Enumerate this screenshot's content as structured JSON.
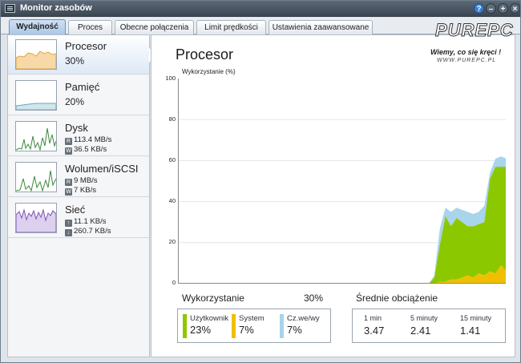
{
  "window": {
    "title": "Monitor zasobów"
  },
  "titlebar_buttons": [
    {
      "icon": "help-icon",
      "glyph": "?"
    },
    {
      "icon": "minimize-icon",
      "glyph": "–"
    },
    {
      "icon": "maximize-icon",
      "glyph": "+"
    },
    {
      "icon": "close-icon",
      "glyph": "×"
    }
  ],
  "tabs": [
    {
      "label": "Wydajność",
      "active": true
    },
    {
      "label": "Proces",
      "active": false
    },
    {
      "label": "Obecne połączenia",
      "active": false
    },
    {
      "label": "Limit prędkości",
      "active": false
    },
    {
      "label": "Ustawienia zaawansowane",
      "active": false
    }
  ],
  "sidebar": {
    "items": [
      {
        "name": "Procesor",
        "value": "30%",
        "selected": true,
        "color": "#e4a33a"
      },
      {
        "name": "Pamięć",
        "value": "20%",
        "selected": false,
        "color": "#6aa6b8"
      },
      {
        "name": "Dysk",
        "read_badge": "R",
        "read": "113.4 MB/s",
        "write_badge": "W",
        "write": "36.5 KB/s",
        "color": "#3a8a3a"
      },
      {
        "name": "Wolumen/iSCSI",
        "read_badge": "R",
        "read": "9 MB/s",
        "write_badge": "W",
        "write": "7 KB/s",
        "color": "#3a8a3a"
      },
      {
        "name": "Sieć",
        "up_badge": "↑",
        "up": "11.1 KB/s",
        "down_badge": "↓",
        "down": "260.7 KB/s",
        "color": "#7a55b5"
      }
    ]
  },
  "main": {
    "title": "Procesor",
    "ylabel": "Wykorzystanie (%)",
    "yticks": [
      "100",
      "80",
      "60",
      "40",
      "20",
      "0"
    ]
  },
  "chart_data": {
    "type": "area",
    "ylabel": "Wykorzystanie (%)",
    "ylim": [
      0,
      100
    ],
    "grid": true,
    "x_sample_count": 60,
    "series": [
      {
        "name": "System",
        "color": "#f0c000",
        "values": [
          0,
          0,
          0,
          0,
          0,
          0,
          0,
          0,
          0,
          0,
          0,
          0,
          0,
          0,
          0,
          0,
          0,
          0,
          0,
          0,
          0,
          0,
          0,
          0,
          0,
          0,
          0,
          0,
          0,
          0,
          0,
          0,
          0,
          0,
          0,
          0,
          0,
          0,
          0,
          0,
          0,
          0,
          0,
          0,
          0,
          0,
          0,
          1,
          1,
          2,
          2,
          3,
          4,
          3,
          5,
          4,
          6,
          5,
          9,
          6
        ]
      },
      {
        "name": "Użytkownik",
        "color": "#8cc800",
        "values": [
          0,
          0,
          0,
          0,
          0,
          0,
          0,
          0,
          0,
          0,
          0,
          0,
          0,
          0,
          0,
          0,
          0,
          0,
          0,
          0,
          0,
          0,
          0,
          0,
          0,
          0,
          0,
          0,
          0,
          0,
          0,
          0,
          0,
          0,
          0,
          0,
          0,
          0,
          0,
          0,
          0,
          0,
          0,
          0,
          0,
          0,
          3,
          18,
          32,
          26,
          30,
          27,
          24,
          25,
          24,
          26,
          45,
          52,
          48,
          51
        ]
      },
      {
        "name": "Cz.we/wy",
        "color": "#a8d4ec",
        "values": [
          0,
          0,
          0,
          0,
          0,
          0,
          0,
          0,
          0,
          0,
          0,
          0,
          0,
          0,
          0,
          0,
          0,
          0,
          0,
          0,
          0,
          0,
          0,
          0,
          0,
          0,
          0,
          0,
          0,
          0,
          0,
          0,
          0,
          0,
          0,
          0,
          0,
          0,
          0,
          0,
          0,
          0,
          0,
          0,
          0,
          0,
          1,
          8,
          4,
          7,
          5,
          6,
          7,
          6,
          6,
          8,
          3,
          4,
          5,
          4
        ]
      }
    ]
  },
  "utilization": {
    "label": "Wykorzystanie",
    "total": "30%",
    "items": [
      {
        "label": "Użytkownik",
        "value": "23%",
        "color": "#8cc800"
      },
      {
        "label": "System",
        "value": "7%",
        "color": "#f0c000"
      },
      {
        "label": "Cz.we/wy",
        "value": "7%",
        "color": "#a8d4ec"
      }
    ]
  },
  "load": {
    "label": "Średnie obciążenie",
    "items": [
      {
        "label": "1 min",
        "value": "3.47"
      },
      {
        "label": "5 minuty",
        "value": "2.41"
      },
      {
        "label": "15 minuty",
        "value": "1.41"
      }
    ]
  },
  "watermark": {
    "brand": "PUREPC",
    "slogan": "Wiemy, co się kręci !",
    "url": "WWW.PUREPC.PL"
  }
}
